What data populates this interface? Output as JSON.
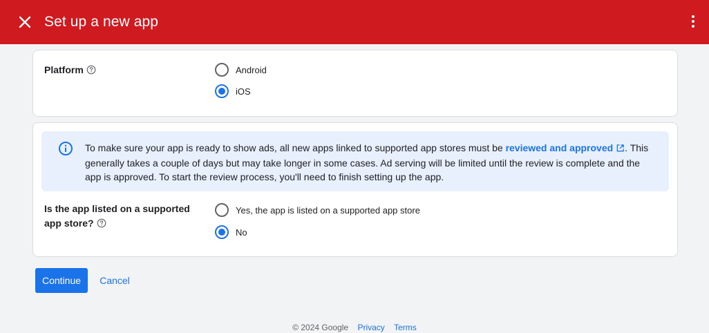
{
  "header": {
    "title": "Set up a new app",
    "background_color": "#cf1b1f"
  },
  "platform": {
    "label": "Platform",
    "options": [
      "Android",
      "iOS"
    ],
    "selected": "iOS"
  },
  "info": {
    "text_before": "To make sure your app is ready to show ads, all new apps linked to supported app stores must be ",
    "link_text": "reviewed and approved",
    "text_after": ". This generally takes a couple of days but may take longer in some cases. Ad serving will be limited until the review is complete and the app is approved. To start the review process, you'll need to finish setting up the app."
  },
  "listed": {
    "label_line1": "Is the app listed on a supported",
    "label_line2": "app store?",
    "options": [
      "Yes, the app is listed on a supported app store",
      "No"
    ],
    "selected": "No"
  },
  "actions": {
    "continue_label": "Continue",
    "cancel_label": "Cancel"
  },
  "footer": {
    "copyright": "© 2024 Google",
    "links": [
      "Privacy",
      "Terms"
    ]
  },
  "colors": {
    "accent": "#1a73e8",
    "info_background": "#e8f0fe"
  },
  "icons": {
    "close": "close-icon",
    "more": "more-vert-icon",
    "help": "help-outline-icon",
    "info": "info-outline-icon",
    "external_link": "open-in-new-icon"
  }
}
